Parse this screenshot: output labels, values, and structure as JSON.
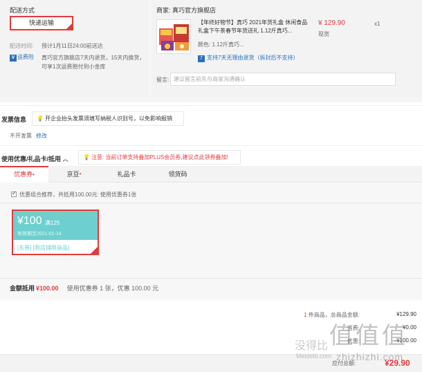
{
  "shipping": {
    "title": "配送方式",
    "method_button": "快递运输",
    "time_label": "配送时间:",
    "time_value": "预计1月11日24:00前送达",
    "freight_badge": "运费险",
    "freight_text": "真巧官方旗舰店7天内退货，15天内换货，可享1次运费赔付到小金库"
  },
  "product": {
    "shop_label": "商家: 真巧官方旗舰店",
    "name": "【年终好物节】真巧 2021年货礼盒 休闲食品礼盒下午茶春节年货送礼 1.12斤真巧...",
    "price": "¥ 129.90",
    "stock": "现货",
    "qty": "x1",
    "color_label": "颜色: 1.12斤真巧...",
    "return_policy": "支持7天无理由退货（拆封后不支持）",
    "message_label": "留言:",
    "message_placeholder": "建议留言前先与商家沟通确认"
  },
  "invoice": {
    "title": "发票信息",
    "tip": "开企业抬头发票须填写纳税人识别号，以免影响报销",
    "value": "不开发票",
    "edit": "修改"
  },
  "coupon": {
    "title": "使用优惠/礼品卡/抵用",
    "toggle_icon": "chevron-up-icon",
    "tip": "注意: 当前订单支持叠加PLUS会员券,建议点此领券叠加!",
    "tabs": [
      {
        "label": "优惠券",
        "dot": "•"
      },
      {
        "label": "京豆",
        "dot": "•"
      },
      {
        "label": "礼品卡",
        "dot": ""
      },
      {
        "label": "领货码",
        "dot": ""
      }
    ],
    "combo_text": "优惠组合推荐，共抵用100.00元: 使用优惠券1张",
    "card": {
      "amount": "¥100",
      "condition": "满125",
      "expiry": "有效期至2021-01-14",
      "tags": "[东券] [限店铺限商品]"
    },
    "deduct_label": "金额抵用",
    "deduct_value": "¥100.00",
    "deduct_note": "使用优惠券 1 张，优惠 100.00 元"
  },
  "summary": {
    "count_prefix": "1",
    "count_label": "件商品，总商品金额:",
    "total": "¥129.90",
    "row2_label": "运费:",
    "row2_value": "¥0.00",
    "row3_label": "优惠:",
    "row3_value": "-¥100.00",
    "pay_label": "应付总额:",
    "pay_value": "¥29.90"
  },
  "watermark": {
    "big": "值值值",
    "cn": "没得比",
    "en": "Meidebi.com",
    "en2": "zhizhizhi.com"
  },
  "colors": {
    "accent_red": "#e4393c",
    "link_blue": "#2b6fb7",
    "coupon_teal": "#6dcfcf"
  }
}
